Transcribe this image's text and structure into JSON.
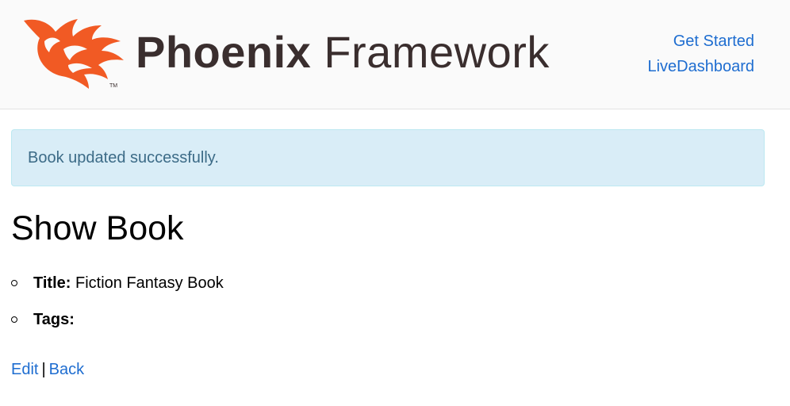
{
  "header": {
    "logo": {
      "brand_bold": "Phoenix",
      "brand_light": "Framework",
      "trademark": "TM"
    },
    "nav": [
      {
        "label": "Get Started"
      },
      {
        "label": "LiveDashboard"
      }
    ]
  },
  "flash": {
    "message": "Book updated successfully."
  },
  "main": {
    "title": "Show Book",
    "fields": [
      {
        "label": "Title:",
        "value": "Fiction Fantasy Book"
      },
      {
        "label": "Tags:",
        "value": ""
      }
    ],
    "actions": {
      "edit_label": "Edit",
      "separator": "|",
      "back_label": "Back"
    }
  },
  "colors": {
    "link": "#1e6dd0",
    "logo_flame": "#f15a24",
    "logo_text": "#3a2e2e",
    "flash_bg": "#d9edf7",
    "flash_text": "#3c6b87",
    "header_bg": "#fafafa"
  }
}
